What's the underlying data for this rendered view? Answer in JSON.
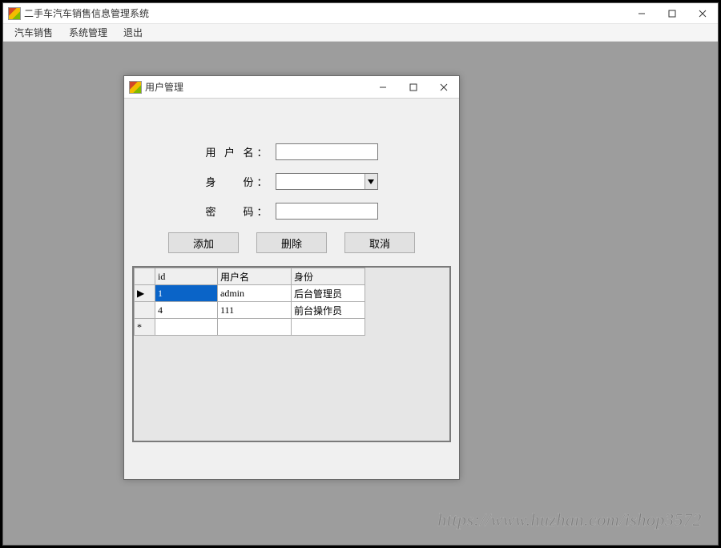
{
  "main": {
    "title": "二手车汽车销售信息管理系统",
    "menu": [
      "汽车销售",
      "系统管理",
      "退出"
    ]
  },
  "dialog": {
    "title": "用户管理",
    "labels": {
      "username": "用户名",
      "role": "身　份",
      "password": "密　码"
    },
    "inputs": {
      "username": "",
      "role": "",
      "password": ""
    },
    "buttons": {
      "add": "添加",
      "delete": "删除",
      "cancel": "取消"
    },
    "grid": {
      "columns": [
        "id",
        "用户名",
        "身份"
      ],
      "rows": [
        {
          "id": "1",
          "user": "admin",
          "role": "后台管理员",
          "selected": true
        },
        {
          "id": "4",
          "user": "111",
          "role": "前台操作员",
          "selected": false
        }
      ],
      "rowIndicators": {
        "current": "▶",
        "new": "*"
      }
    }
  },
  "watermark": "https://www.huzhan.com/ishop3572"
}
